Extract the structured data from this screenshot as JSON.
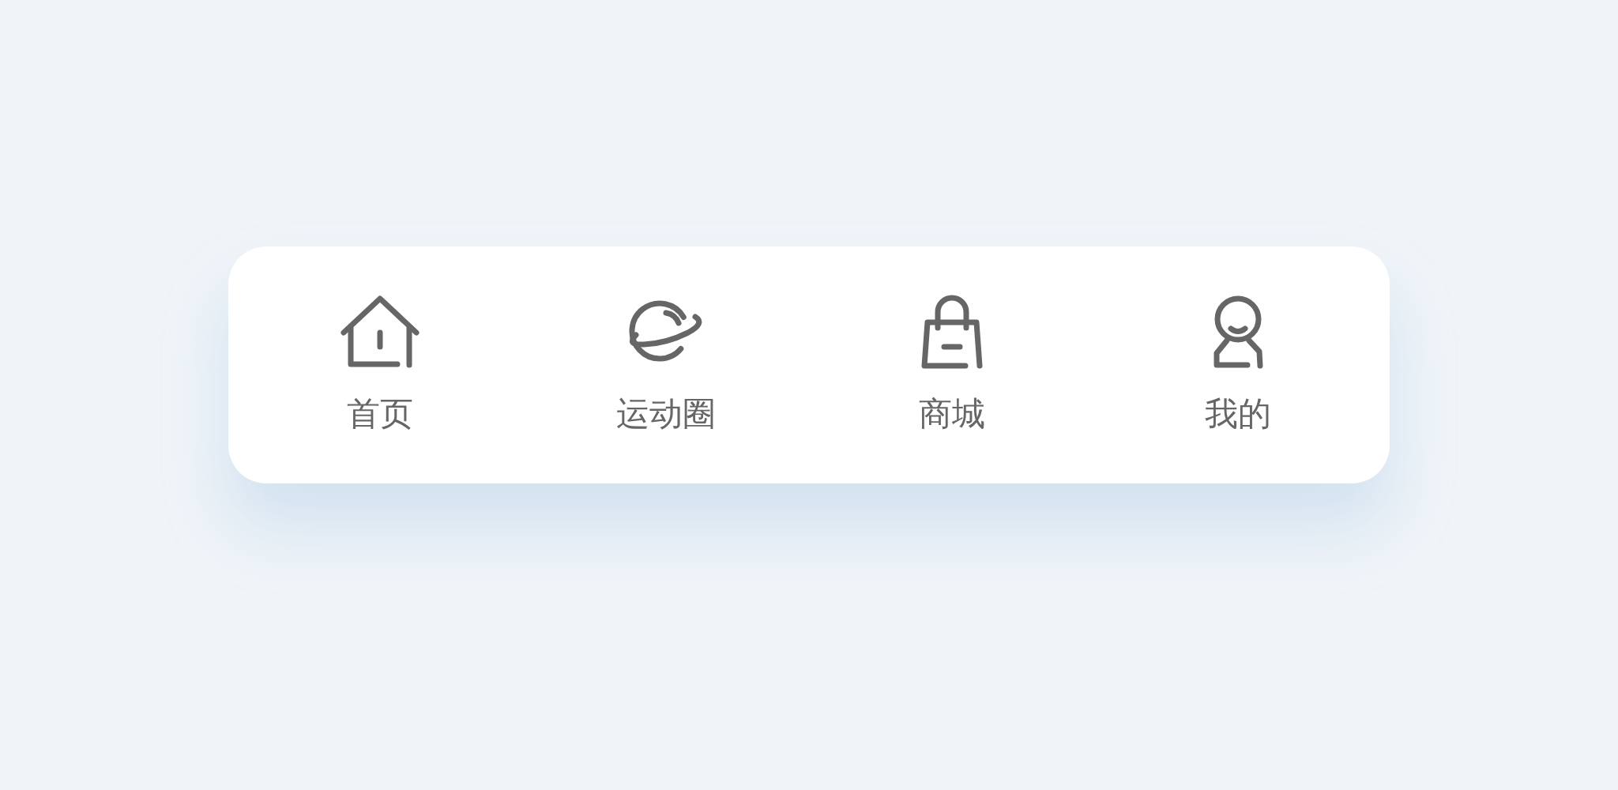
{
  "tab_bar": {
    "items": [
      {
        "kind": "home",
        "label": "首页"
      },
      {
        "kind": "planet",
        "label": "运动圈"
      },
      {
        "kind": "bag",
        "label": "商城"
      },
      {
        "kind": "person",
        "label": "我的"
      }
    ]
  }
}
